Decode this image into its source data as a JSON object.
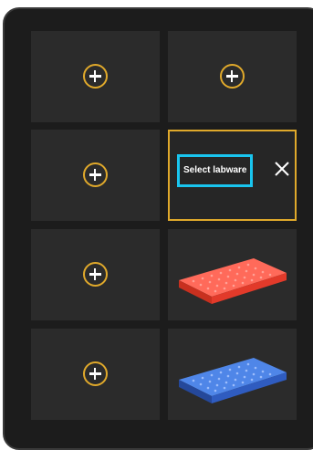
{
  "deck": {
    "slots": [
      {
        "state": "empty",
        "icon": "plus-circle-icon"
      },
      {
        "state": "empty",
        "icon": "plus-circle-icon"
      },
      {
        "state": "empty",
        "icon": "plus-circle-icon"
      },
      {
        "state": "selecting",
        "select_label": "Select labware",
        "close_icon": "close-icon"
      },
      {
        "state": "empty",
        "icon": "plus-circle-icon"
      },
      {
        "state": "occupied",
        "labware_color": "red",
        "icon": "well-plate-icon"
      },
      {
        "state": "empty",
        "icon": "plus-circle-icon"
      },
      {
        "state": "occupied",
        "labware_color": "blue",
        "icon": "well-plate-icon"
      }
    ]
  },
  "colors": {
    "accent": "#e0a92b",
    "highlight": "#19c5ef",
    "panel_background": "#1c1c1c",
    "slot_background": "#2b2b2b",
    "red_plate": "#f2483a",
    "blue_plate": "#3b6fd1"
  }
}
